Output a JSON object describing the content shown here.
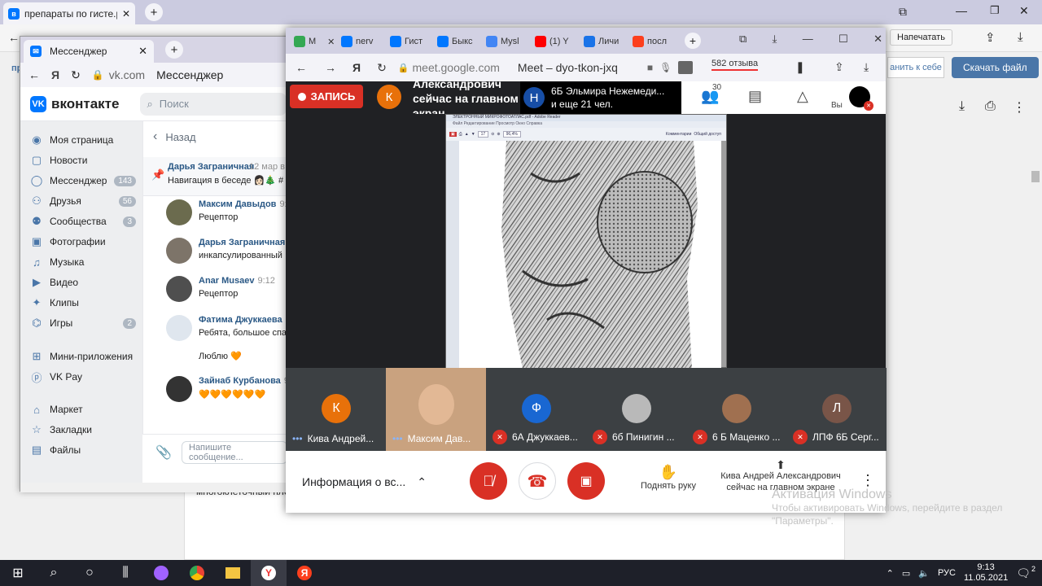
{
  "bg_browser": {
    "tab_title": "препараты по гисте.р",
    "print_button": "Напечатать",
    "save_to_self_button": "анить к себе",
    "download_button": "Скачать файл",
    "doc_fragment": "многоклеточный плос",
    "left_cut": "пр"
  },
  "vk_window": {
    "tab_title": "Мессенджер",
    "address_domain": "vk.com",
    "address_title": "Мессенджер",
    "logo_text": "вконтакте",
    "search_placeholder": "Поиск",
    "sidebar": [
      {
        "label": "Моя страница",
        "icon": "user-circle-icon",
        "badge": ""
      },
      {
        "label": "Новости",
        "icon": "news-icon",
        "badge": ""
      },
      {
        "label": "Мессенджер",
        "icon": "chat-icon",
        "badge": "143"
      },
      {
        "label": "Друзья",
        "icon": "friends-icon",
        "badge": "56"
      },
      {
        "label": "Сообщества",
        "icon": "communities-icon",
        "badge": "3"
      },
      {
        "label": "Фотографии",
        "icon": "photo-icon",
        "badge": ""
      },
      {
        "label": "Музыка",
        "icon": "music-icon",
        "badge": ""
      },
      {
        "label": "Видео",
        "icon": "video-icon",
        "badge": ""
      },
      {
        "label": "Клипы",
        "icon": "clips-icon",
        "badge": ""
      },
      {
        "label": "Игры",
        "icon": "gamepad-icon",
        "badge": "2"
      },
      {
        "label": "Мини-приложения",
        "icon": "apps-icon",
        "badge": ""
      },
      {
        "label": "VK Pay",
        "icon": "vkpay-icon",
        "badge": ""
      },
      {
        "label": "Маркет",
        "icon": "market-icon",
        "badge": ""
      },
      {
        "label": "Закладки",
        "icon": "bookmark-icon",
        "badge": ""
      },
      {
        "label": "Файлы",
        "icon": "file-icon",
        "badge": ""
      }
    ],
    "back_label": "Назад",
    "pinned": {
      "name": "Дарья Заграничная",
      "time": "12 мар в",
      "text": "Навигация в беседе 👩🏻🎄 #"
    },
    "messages": [
      {
        "name": "Максим Давыдов",
        "time": "9:1",
        "text": "Рецептор"
      },
      {
        "name": "Дарья Заграничная",
        "time": "9",
        "text": "инкапсулированный"
      },
      {
        "name": "Anar Musaev",
        "time": "9:12",
        "text": "Рецептор"
      },
      {
        "name": "Фатима Джуккаева",
        "time": "",
        "text": "Ребята, большое спас"
      },
      {
        "name": "",
        "time": "",
        "text": "Люблю 🧡"
      },
      {
        "name": "Зайнаб Курбанова",
        "time": "9:",
        "text": "🧡🧡🧡🧡🧡🧡"
      }
    ],
    "input_placeholder": "Напишите сообщение..."
  },
  "meet_window": {
    "tabs": [
      {
        "label": "M",
        "icon": "meet-favicon",
        "color": "#34a853"
      },
      {
        "label": "nerv",
        "icon": "vk-favicon",
        "color": "#0077ff"
      },
      {
        "label": "Гист",
        "icon": "vk-favicon",
        "color": "#0077ff"
      },
      {
        "label": "Быкс",
        "icon": "vk-favicon",
        "color": "#0077ff"
      },
      {
        "label": "Mysl",
        "icon": "docs-favicon",
        "color": "#4285f4"
      },
      {
        "label": "(1) Y",
        "icon": "youtube-favicon",
        "color": "#ff0000"
      },
      {
        "label": "Личи",
        "icon": "bookmark-favicon",
        "color": "#1a73e8"
      },
      {
        "label": "посл",
        "icon": "yandex-favicon",
        "color": "#fc3f1d"
      }
    ],
    "address_domain": "meet.google.com",
    "address_title": "Meet – dyo-tkon-jxq",
    "reviews": "582 отзыва",
    "record_label": "ЗАПИСЬ",
    "presenter_initial": "К",
    "presenter_text": "Александрович сейчас на главном экран",
    "banner_initial": "Н",
    "banner_text_1": "6Б Эльмира Нежемеди...",
    "banner_text_2": "и еще 21 чел.",
    "people_count": "30",
    "you_label": "Вы",
    "pdf_title": "ЭЛЕКТРОННЫЙ МИКРОФОТОАТЛАС.pdf - Adobe Reader",
    "pdf_menu": "Файл   Редактирование   Просмотр   Окно   Справка",
    "pdf_page": "17",
    "pdf_zoom": "96,4%",
    "pdf_comments": "Комментарии",
    "pdf_share": "Общий доступ",
    "participants": [
      {
        "name": "Кива Андрей...",
        "initial": "К",
        "color": "#e8710a",
        "muted": false,
        "speaking": true
      },
      {
        "name": "Максим Дав...",
        "initial": "",
        "color": "#c9a27f",
        "muted": false,
        "speaking": true
      },
      {
        "name": "6А Джуккаев...",
        "initial": "Ф",
        "color": "#1967d2",
        "muted": true,
        "speaking": false
      },
      {
        "name": "6б Пинигин ...",
        "initial": "",
        "color": "#b9b9b9",
        "muted": true,
        "speaking": false
      },
      {
        "name": "6 Б Маценко ...",
        "initial": "",
        "color": "#a07050",
        "muted": true,
        "speaking": false
      },
      {
        "name": "ЛПФ 6Б Серг...",
        "initial": "Л",
        "color": "#795548",
        "muted": true,
        "speaking": false
      }
    ],
    "info_label": "Информация о вс...",
    "raise_hand_label": "Поднять руку",
    "presenting_label": "Кива Андрей Александрович сейчас на главном экране",
    "accent": "#d93025"
  },
  "watermark": {
    "line1": "Активация Windows",
    "line2": "Чтобы активировать Windows, перейдите в раздел",
    "line3": "\"Параметры\"."
  },
  "taskbar": {
    "lang": "РУС",
    "time": "9:13",
    "date": "11.05.2021",
    "notifications": "2"
  }
}
